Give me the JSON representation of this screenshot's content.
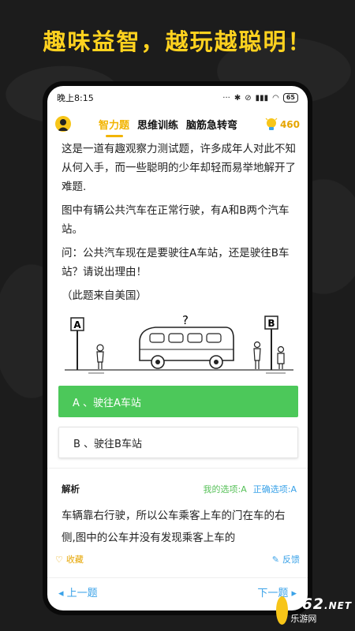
{
  "headline": "趣味益智，越玩越聪明！",
  "status": {
    "time": "晚上8:15",
    "battery": "65"
  },
  "nav": {
    "tabs": [
      {
        "label": "智力题",
        "active": true
      },
      {
        "label": "思维训练",
        "active": false
      },
      {
        "label": "脑筋急转弯",
        "active": false
      }
    ],
    "score": "460"
  },
  "question": {
    "p1": "这是一道有趣观察力测试题，许多成年人对此不知从何入手，而一些聪明的少年却轻而易举地解开了难题.",
    "p2": "图中有辆公共汽车在正常行驶，有A和B两个汽车站。",
    "p3": "问：公共汽车现在是要驶往A车站，还是驶往B车站？请说出理由！",
    "p4": "（此题来自美国）",
    "illustration": {
      "sign_a": "A",
      "sign_b": "B",
      "mark": "?"
    }
  },
  "options": [
    {
      "label": "A 、驶往A车站",
      "state": "correct"
    },
    {
      "label": "B 、驶往B车站",
      "state": "plain"
    }
  ],
  "analysis": {
    "title": "解析",
    "my_choice": "我的选项:A",
    "correct_choice": "正确选项:A",
    "text": "车辆靠右行驶，所以公车乘客上车的门在车的右侧,图中的公车并没有发现乘客上车的"
  },
  "actions": {
    "favorite": "收藏",
    "report": "反馈"
  },
  "pager": {
    "prev": "上一题",
    "next": "下一题"
  },
  "watermark": {
    "number": "962",
    "net": ".NET",
    "sub": "乐游网"
  },
  "colors": {
    "accent": "#f2b400",
    "headline": "#ffd21f",
    "correct": "#4cc85a",
    "link": "#3aa2e8"
  }
}
